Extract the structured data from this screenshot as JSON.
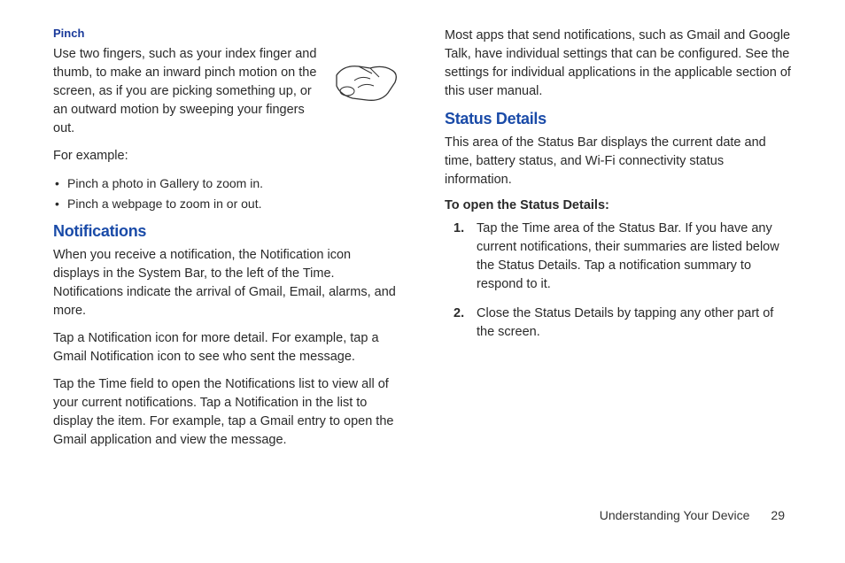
{
  "left": {
    "pinch": {
      "label": "Pinch",
      "body": "Use two fingers, such as your index finger and thumb, to make an inward pinch motion on the screen, as if you are picking something up, or an outward motion by sweeping your fingers out.",
      "example_label": "For example:",
      "bullets": [
        "Pinch a photo in Gallery to zoom in.",
        "Pinch a webpage to zoom in or out."
      ]
    },
    "notifications": {
      "heading": "Notifications",
      "p1": "When you receive a notification, the Notification icon displays in the System Bar, to the left of the Time. Notifications indicate the arrival of Gmail, Email, alarms, and more.",
      "p2": "Tap a Notification icon for more detail. For example, tap a Gmail Notification icon to see who sent the message.",
      "p3": "Tap the Time field to open the Notifications list to view all of your current notifications. Tap a Notification in the list to display the item. For example, tap a Gmail entry to open the Gmail application and view the message."
    }
  },
  "right": {
    "continuation": "Most apps that send notifications, such as Gmail and Google Talk, have individual settings that can be configured. See the settings for individual applications in the applicable section of this user manual.",
    "status": {
      "heading": "Status Details",
      "intro": "This area of the Status Bar displays the current date and time, battery status, and Wi-Fi connectivity status information.",
      "open_label": "To open the Status Details:",
      "steps": [
        "Tap the Time area of the Status Bar. If you have any current notifications, their summaries are listed below the Status Details. Tap a notification summary to respond to it.",
        "Close the Status Details by tapping any other part of the screen."
      ]
    }
  },
  "footer": {
    "section": "Understanding Your Device",
    "page": "29"
  }
}
